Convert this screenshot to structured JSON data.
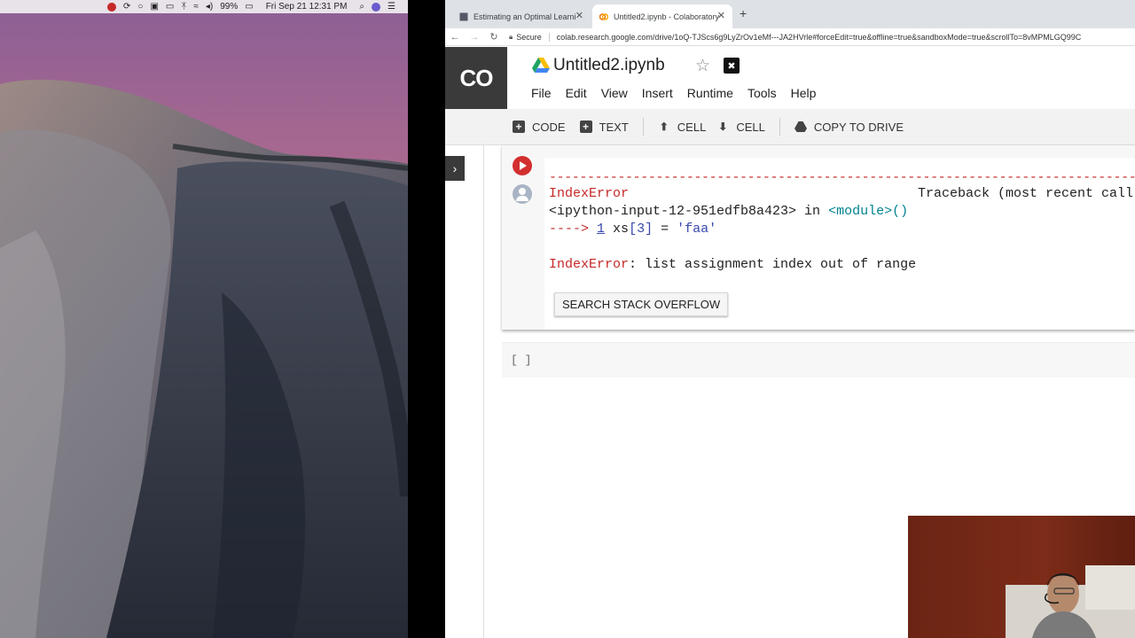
{
  "menubar": {
    "battery": "99%",
    "datetime": "Fri Sep 21  12:31 PM"
  },
  "browser": {
    "tabs": [
      {
        "label": "Estimating an Optimal Learning",
        "active": false
      },
      {
        "label": "Untitled2.ipynb - Colaboratory",
        "active": true
      }
    ],
    "secure_label": "Secure",
    "url": "colab.research.google.com/drive/1oQ-TJScs6g9LyZrOv1eMf---JA2HVrle#forceEdit=true&offline=true&sandboxMode=true&scrollTo=8vMPMLGQ99C"
  },
  "colab": {
    "logo": "CO",
    "title": "Untitled2.ipynb",
    "menu": [
      "File",
      "Edit",
      "View",
      "Insert",
      "Runtime",
      "Tools",
      "Help"
    ],
    "toolbar": {
      "code": "CODE",
      "text": "TEXT",
      "cell_up": "CELL",
      "cell_down": "CELL",
      "copy_to_drive": "COPY TO DRIVE"
    }
  },
  "output": {
    "dashes": "------------------------------------------------------------------------------------",
    "error_name": "IndexError",
    "traceback_header": "Traceback (most recent call last)",
    "input_ref": "<ipython-input-12-951edfb8a423>",
    "in_word": " in ",
    "module": "<module>()",
    "arrow": "---->",
    "line_no": "1",
    "code_pre": " xs",
    "code_index": "[3]",
    "code_eq": " = ",
    "code_str": "'faa'",
    "error_label": "IndexError",
    "error_message": ": list assignment index out of range",
    "so_button": "SEARCH STACK OVERFLOW"
  },
  "empty_cell": {
    "bracket": "[ ]"
  },
  "colors": {
    "error_red": "#c62828",
    "run_button": "#d32f2f",
    "colab_dark": "#3a3a3a",
    "toolbar_bg": "#f2f2f2"
  }
}
